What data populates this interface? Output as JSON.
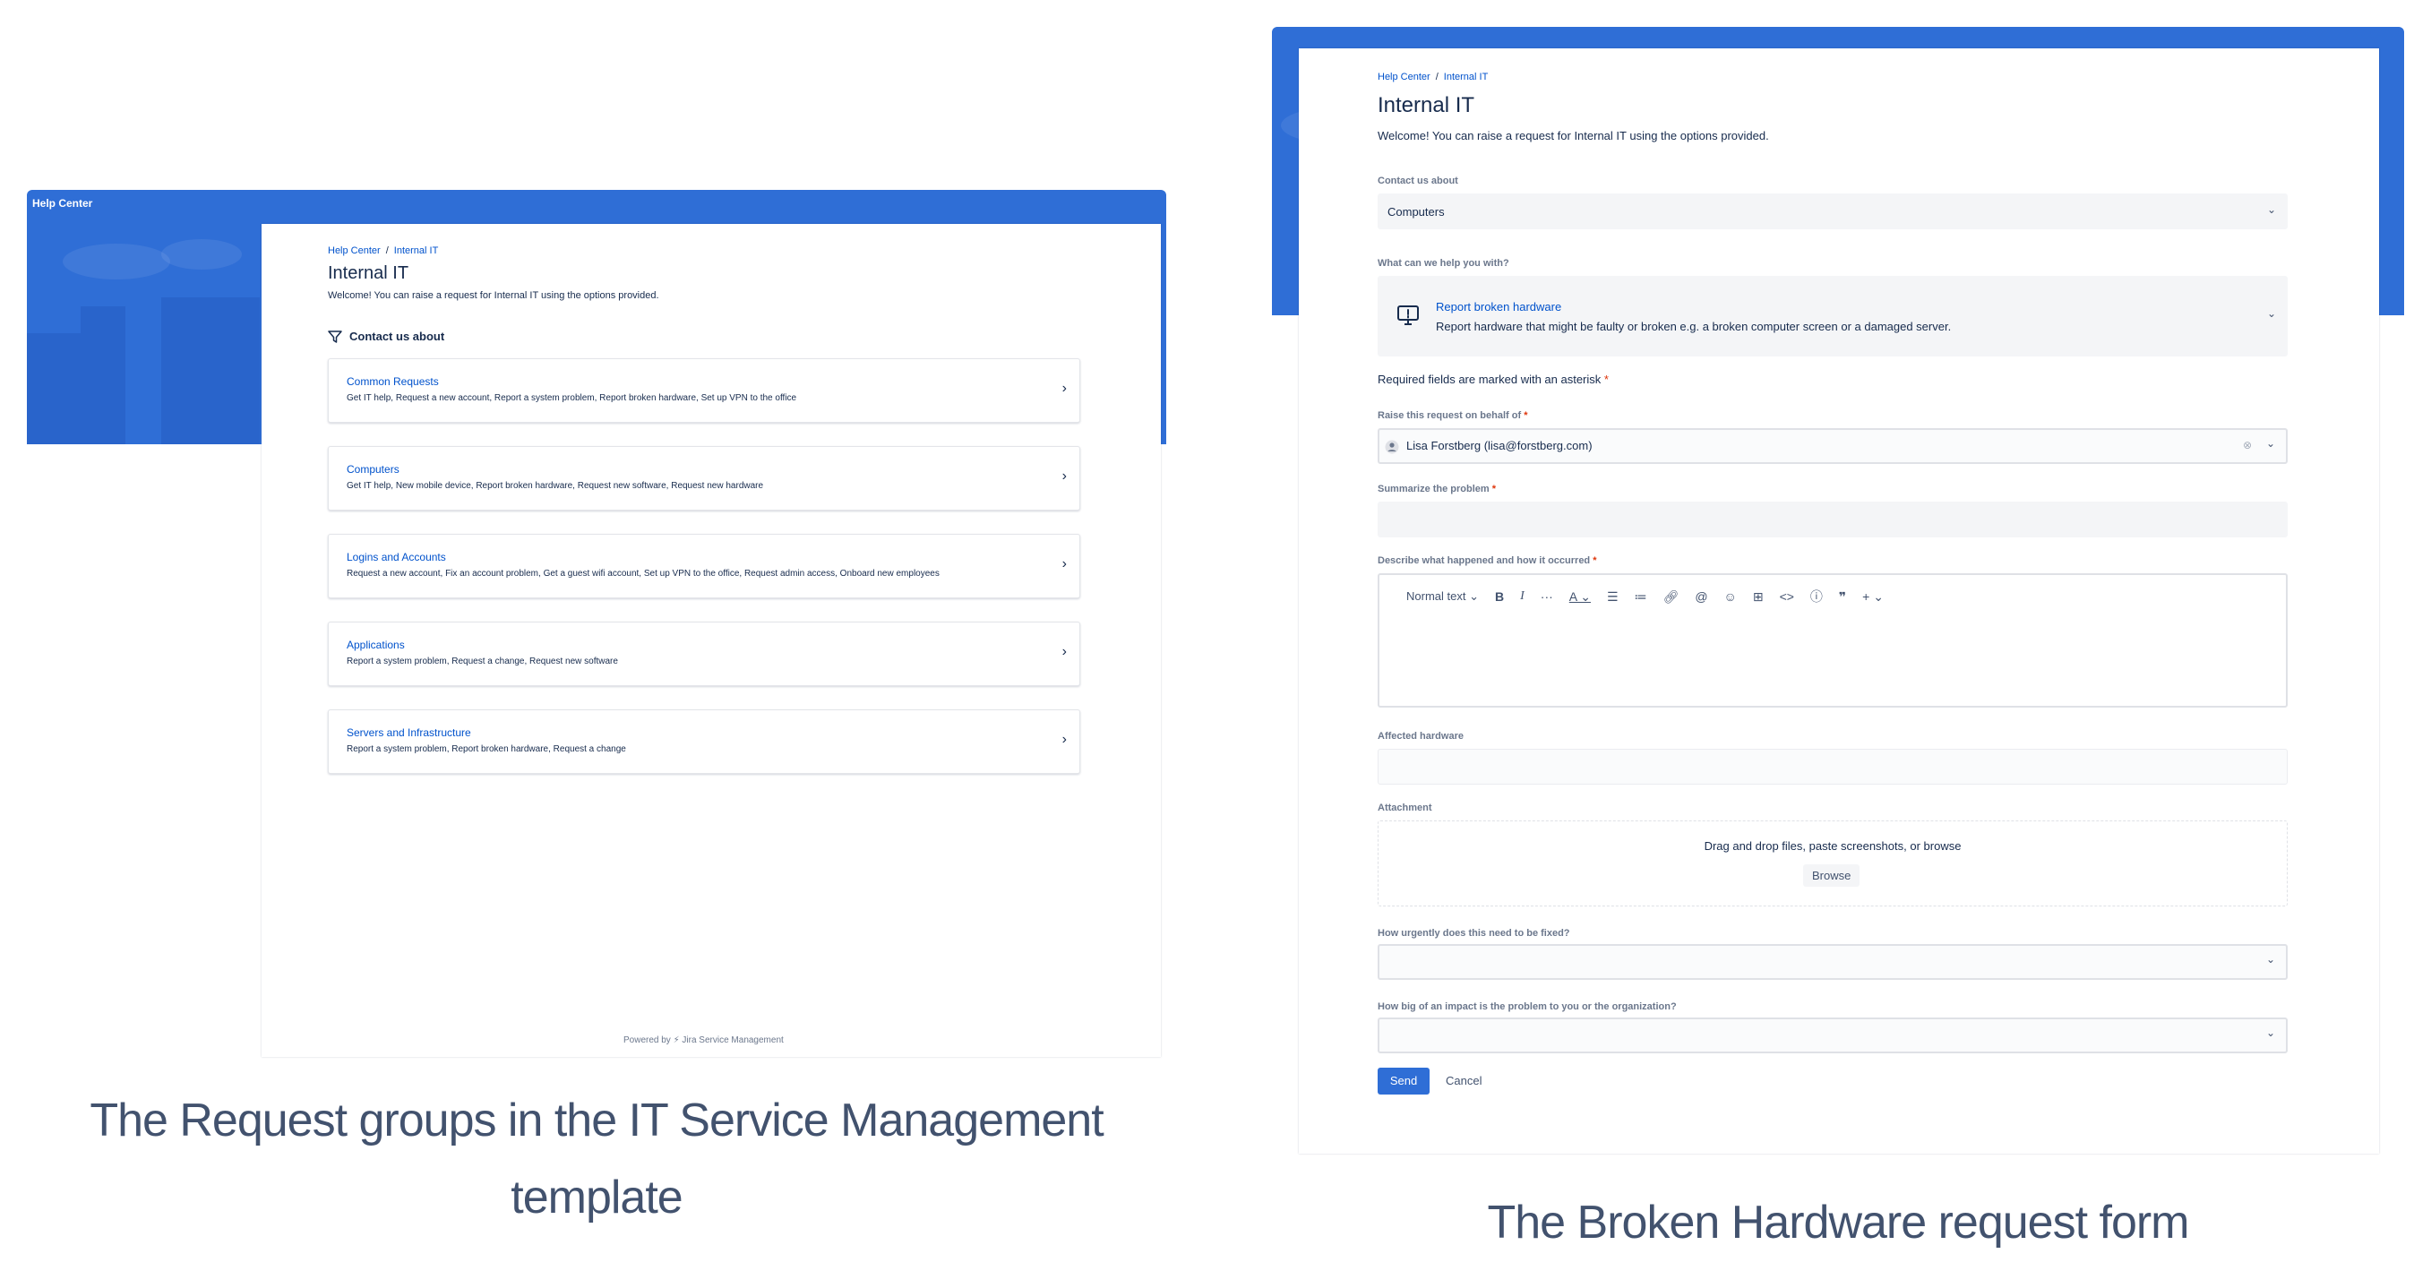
{
  "left": {
    "help_center": "Help Center",
    "breadcrumb": [
      "Help Center",
      "Internal IT"
    ],
    "title": "Internal IT",
    "welcome": "Welcome! You can raise a request for Internal IT using the options provided.",
    "contact_heading": "Contact us about",
    "groups": [
      {
        "title": "Common Requests",
        "desc": "Get IT help, Request a new account, Report a system problem, Report broken hardware, Set up VPN to the office"
      },
      {
        "title": "Computers",
        "desc": "Get IT help, New mobile device, Report broken hardware, Request new software, Request new hardware"
      },
      {
        "title": "Logins and Accounts",
        "desc": "Request a new account, Fix an account problem, Get a guest wifi account, Set up VPN to the office, Request admin access, Onboard new employees"
      },
      {
        "title": "Applications",
        "desc": "Report a system problem, Request a change, Request new software"
      },
      {
        "title": "Servers and Infrastructure",
        "desc": "Report a system problem, Report broken hardware, Request a change"
      }
    ],
    "powered_prefix": "Powered by",
    "powered_product": "Jira Service Management",
    "caption_line1": "The Request groups in the IT Service Management",
    "caption_line2": "template"
  },
  "right": {
    "breadcrumb": [
      "Help Center",
      "Internal IT"
    ],
    "title": "Internal IT",
    "welcome": "Welcome! You can raise a request for Internal IT using the options provided.",
    "contact_label": "Contact us about",
    "contact_value": "Computers",
    "help_label": "What can we help you with?",
    "request_type_title": "Report broken hardware",
    "request_type_desc": "Report hardware that might be faulty or broken e.g. a broken computer screen or a damaged server.",
    "required_note": "Required fields are marked with an asterisk",
    "asterisk": "*",
    "behalf_label": "Raise this request on behalf of",
    "behalf_value": "Lisa Forstberg (lisa@forstberg.com)",
    "summary_label": "Summarize the problem",
    "describe_label": "Describe what happened and how it occurred",
    "editor_text_style": "Normal text",
    "affected_label": "Affected hardware",
    "attachment_label": "Attachment",
    "attachment_hint": "Drag and drop files, paste screenshots, or browse",
    "browse_label": "Browse",
    "urgency_label": "How urgently does this need to be fixed?",
    "impact_label": "How big of an impact is the problem to you or the organization?",
    "send_label": "Send",
    "cancel_label": "Cancel",
    "caption": "The Broken Hardware request form"
  },
  "colors": {
    "brand": "#2f6ed6",
    "link": "#0052cc",
    "required": "#de350b"
  }
}
